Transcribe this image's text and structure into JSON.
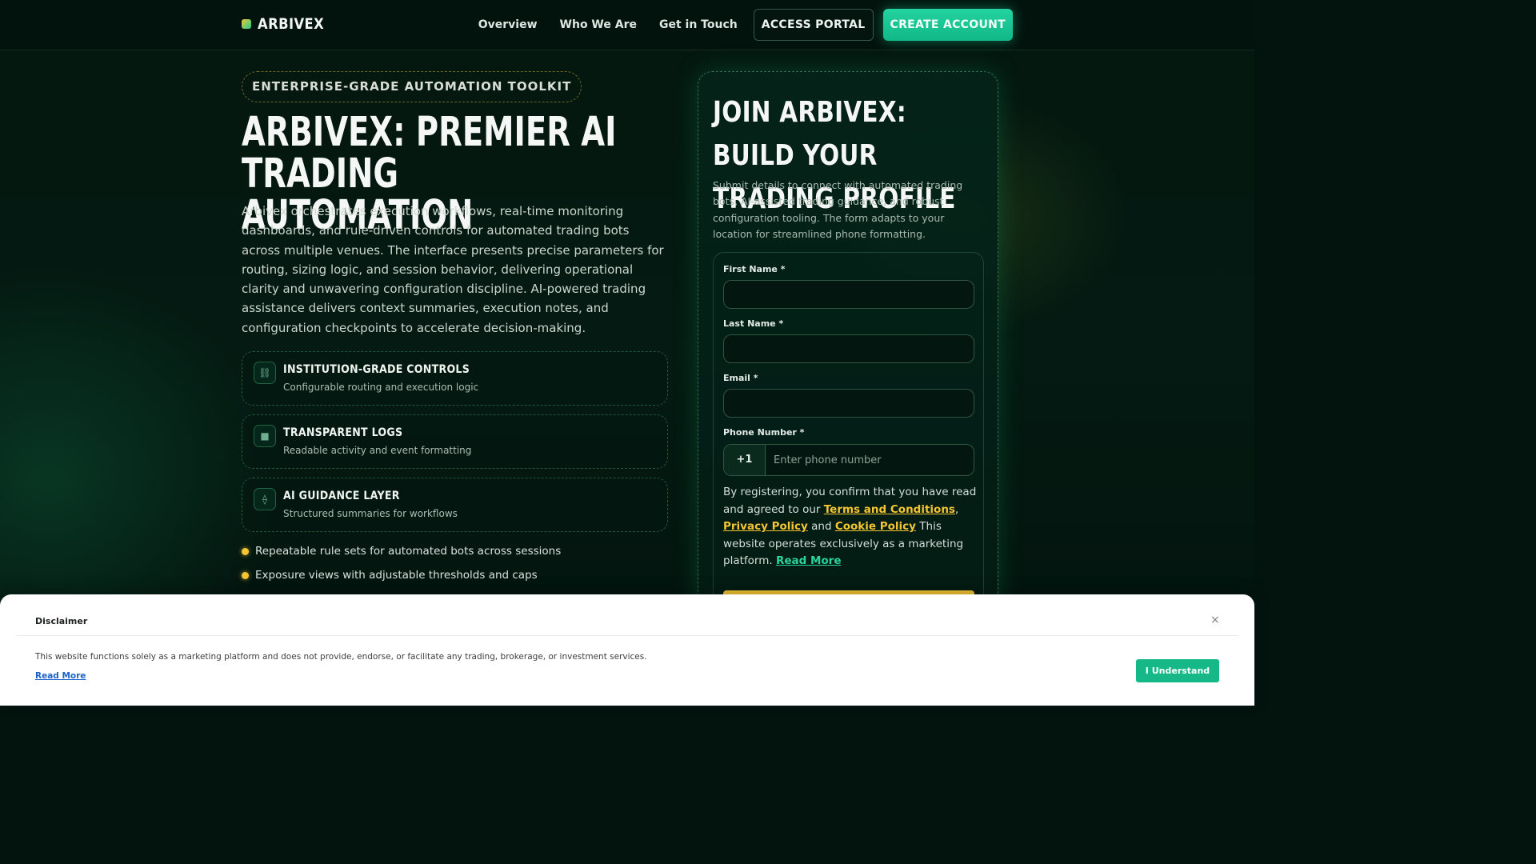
{
  "brand": {
    "name": "ARBIVEX"
  },
  "nav": {
    "links": [
      "Overview",
      "Who We Are",
      "Get in Touch"
    ],
    "portal_label": "ACCESS PORTAL",
    "create_label": "CREATE ACCOUNT"
  },
  "hero": {
    "badge": "ENTERPRISE-GRADE AUTOMATION TOOLKIT",
    "title": "ARBIVEX: PREMIER AI TRADING AUTOMATION",
    "description": "Arbivex orchestrates execution workflows, real-time monitoring dashboards, and rule-driven controls for automated trading bots across multiple venues. The interface presents precise parameters for routing, sizing logic, and session behavior, delivering operational clarity and unwavering configuration discipline. AI-powered trading assistance delivers context summaries, execution notes, and configuration checkpoints to accelerate decision-making.",
    "features": [
      {
        "icon": "link-icon",
        "glyph": "⛓",
        "title": "INSTITUTION-GRADE CONTROLS",
        "subtitle": "Configurable routing and execution logic"
      },
      {
        "icon": "square-icon",
        "glyph": "■",
        "title": "TRANSPARENT LOGS",
        "subtitle": "Readable activity and event formatting"
      },
      {
        "icon": "diamond-icon",
        "glyph": "⟠",
        "title": "AI GUIDANCE LAYER",
        "subtitle": "Structured summaries for workflows"
      }
    ],
    "bullets": [
      "Repeatable rule sets for automated bots across sessions",
      "Exposure views with adjustable thresholds and caps"
    ]
  },
  "form": {
    "title": "JOIN ARBIVEX: BUILD YOUR TRADING PROFILE",
    "description": "Submit details to connect with automated trading bots, AI-assisted trading guidance, and robust configuration tooling. The form adapts to your location for streamlined phone formatting.",
    "first_name_label": "First Name *",
    "last_name_label": "Last Name *",
    "email_label": "Email *",
    "phone_label": "Phone Number *",
    "phone_code": "+1",
    "phone_placeholder": "Enter phone number",
    "consent": {
      "prefix": "By registering, you confirm that you have read and agreed to our ",
      "terms": "Terms and Conditions",
      "comma": ",",
      "privacy": "Privacy Policy",
      "and": " and ",
      "cookie": "Cookie Policy",
      "suffix": " This website operates exclusively as a marketing platform. ",
      "read_more": "Read More"
    }
  },
  "disclaimer": {
    "title": "Disclaimer",
    "close": "×",
    "text": "This website functions solely as a marketing platform and does not provide, endorse, or facilitate any trading, brokerage, or investment services.",
    "read_more": "Read More",
    "button": "I Understand"
  },
  "colors": {
    "accent": "#15b886",
    "gold": "#f4c531",
    "background": "#03140f"
  }
}
